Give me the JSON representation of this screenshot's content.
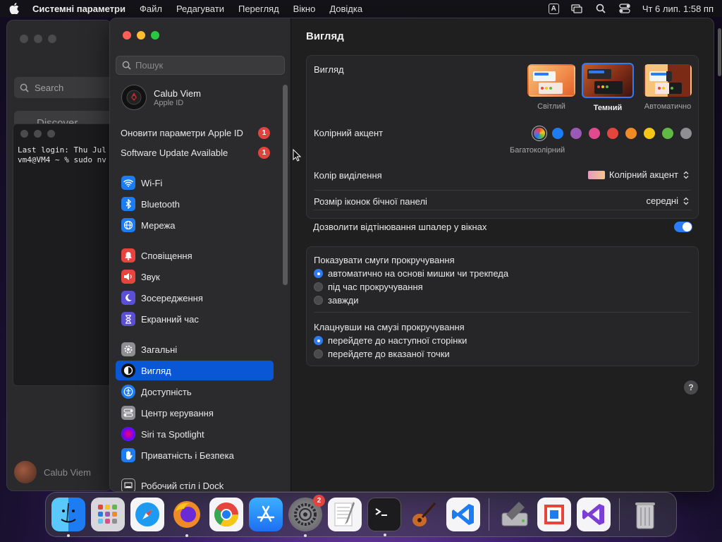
{
  "menubar": {
    "app": "Системні параметри",
    "items": [
      "Файл",
      "Редагувати",
      "Перегляд",
      "Вікно",
      "Довідка"
    ],
    "keyboard_indicator": "A",
    "clock": "Чт 6 лип.  1:58 пп"
  },
  "background_window": {
    "search_placeholder": "Search",
    "discover": "Discover",
    "terminal_lines": "Last login: Thu Jul\nvm4@VM4 ~ % sudo nv",
    "user_name": "Calub Viem"
  },
  "sidebar": {
    "search_placeholder": "Пошук",
    "profile": {
      "name": "Calub Viem",
      "subtitle": "Apple ID"
    },
    "notices": [
      {
        "label": "Оновити параметри Apple ID",
        "badge": "1"
      },
      {
        "label": "Software Update Available",
        "badge": "1"
      }
    ],
    "items": [
      {
        "label": "Wi-Fi",
        "icon": "wifi-icon",
        "color": "#1e7cf2"
      },
      {
        "label": "Bluetooth",
        "icon": "bluetooth-icon",
        "color": "#1e7cf2"
      },
      {
        "label": "Мережа",
        "icon": "globe-icon",
        "color": "#1e7cf2"
      },
      {
        "label": "Сповіщення",
        "icon": "bell-icon",
        "color": "#e5453d"
      },
      {
        "label": "Звук",
        "icon": "speaker-icon",
        "color": "#e5453d"
      },
      {
        "label": "Зосередження",
        "icon": "moon-icon",
        "color": "#5b4fd6"
      },
      {
        "label": "Екранний час",
        "icon": "hourglass-icon",
        "color": "#5b4fd6"
      },
      {
        "label": "Загальні",
        "icon": "gear-icon",
        "color": "#8e8e93"
      },
      {
        "label": "Вигляд",
        "icon": "appearance-icon",
        "color": "#111111"
      },
      {
        "label": "Доступність",
        "icon": "accessibility-icon",
        "color": "#1e7cf2"
      },
      {
        "label": "Центр керування",
        "icon": "control-center-icon",
        "color": "#8e8e93"
      },
      {
        "label": "Siri та Spotlight",
        "icon": "siri-icon",
        "color": "#c03fd6"
      },
      {
        "label": "Приватність і Безпека",
        "icon": "hand-icon",
        "color": "#1e7cf2"
      },
      {
        "label": "Робочий стіл і Dock",
        "icon": "desktop-icon",
        "color": "#2c2c2e"
      }
    ],
    "active_item": "Вигляд"
  },
  "content": {
    "title": "Вигляд",
    "appearance": {
      "label": "Вигляд",
      "options": [
        "Світлий",
        "Темний",
        "Автоматично"
      ],
      "selected": "Темний"
    },
    "accent": {
      "label": "Колірний акцент",
      "colors": [
        "#e5453d",
        "#1e7cf2",
        "#9b59b6",
        "#e04a8f",
        "#e5453d",
        "#f08a24",
        "#f5c518",
        "#5fb944",
        "#8e8e93"
      ],
      "selected_label": "Багатоколірний"
    },
    "highlight": {
      "label": "Колір виділення",
      "value": "Колірний акцент"
    },
    "sidebar_icon_size": {
      "label": "Розмір іконок бічної панелі",
      "value": "середні"
    },
    "wallpaper_tinting": {
      "label": "Дозволити відтінювання шпалер у вікнах",
      "enabled": true
    },
    "scrollbars": {
      "label": "Показувати смуги прокручування",
      "options": [
        "автоматично на основі мишки чи трекпеда",
        "під час прокручування",
        "завжди"
      ],
      "selected": 0
    },
    "click_scroll": {
      "label": "Клацнувши на смузі прокручування",
      "options": [
        "перейдете до наступної сторінки",
        "перейдете до вказаної точки"
      ],
      "selected": 0
    },
    "help": "?"
  },
  "dock": {
    "apps": [
      {
        "name": "finder",
        "badge": ""
      },
      {
        "name": "launchpad",
        "badge": ""
      },
      {
        "name": "safari",
        "badge": ""
      },
      {
        "name": "firefox",
        "badge": ""
      },
      {
        "name": "chrome",
        "badge": ""
      },
      {
        "name": "app-store",
        "badge": ""
      },
      {
        "name": "system-settings",
        "badge": "2"
      },
      {
        "name": "textedit",
        "badge": ""
      },
      {
        "name": "terminal",
        "badge": ""
      },
      {
        "name": "garageband",
        "badge": ""
      },
      {
        "name": "vscode",
        "badge": ""
      },
      {
        "name": "disk-utility",
        "badge": ""
      },
      {
        "name": "parallels",
        "badge": ""
      },
      {
        "name": "visual-studio",
        "badge": ""
      },
      {
        "name": "trash",
        "badge": ""
      }
    ]
  }
}
